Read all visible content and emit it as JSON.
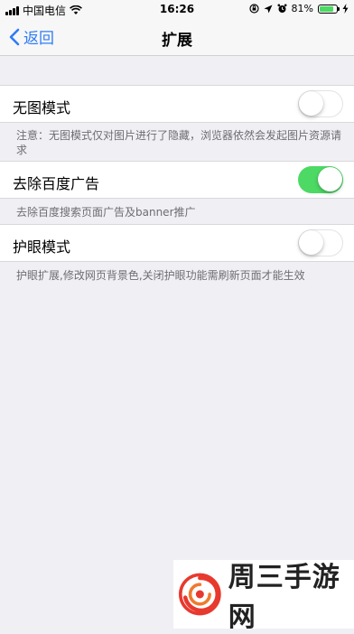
{
  "status_bar": {
    "carrier": "中国电信",
    "time": "16:26",
    "battery_text": "81%",
    "battery_level": 0.81
  },
  "nav": {
    "back_label": "返回",
    "title": "扩展"
  },
  "settings": [
    {
      "label": "无图模式",
      "enabled": false,
      "note": "注意：无图模式仅对图片进行了隐藏，浏览器依然会发起图片资源请求"
    },
    {
      "label": "去除百度广告",
      "enabled": true,
      "note": "去除百度搜索页面广告及banner推广"
    },
    {
      "label": "护眼模式",
      "enabled": false,
      "note": "护眼扩展,修改网页背景色,关闭护眼功能需刷新页面才能生效"
    }
  ],
  "watermark": {
    "text": "周三手游网"
  },
  "colors": {
    "accent": "#2F7CF6",
    "toggle_on": "#4CD964",
    "background": "#EFEFF4"
  }
}
